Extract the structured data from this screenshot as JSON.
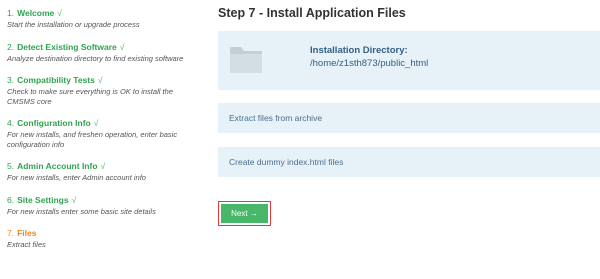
{
  "steps": [
    {
      "num": "1.",
      "label": "Welcome",
      "check": "√",
      "desc": "Start the installation or upgrade process"
    },
    {
      "num": "2.",
      "label": "Detect Existing Software",
      "check": "√",
      "desc": "Analyze destination directory to find existing software"
    },
    {
      "num": "3.",
      "label": "Compatibility Tests",
      "check": "√",
      "desc": "Check to make sure everything is OK to install the CMSMS core"
    },
    {
      "num": "4.",
      "label": "Configuration Info",
      "check": "√",
      "desc": "For new installs, and freshen operation, enter basic configuration info"
    },
    {
      "num": "5.",
      "label": "Admin Account Info",
      "check": "√",
      "desc": "For new installs, enter Admin account info"
    },
    {
      "num": "6.",
      "label": "Site Settings",
      "check": "√",
      "desc": "For new installs enter some basic site details"
    },
    {
      "num": "7.",
      "label": "Files",
      "check": "",
      "desc": "Extract files"
    }
  ],
  "main": {
    "title": "Step 7 - Install Application Files",
    "dir_label": "Installation Directory:",
    "dir_path": "/home/z1sth873/public_html",
    "action1": "Extract files from archive",
    "action2": "Create dummy index.html files",
    "next_label": "Next →"
  },
  "colors": {
    "done_step": "#2fa34f",
    "current_step": "#f0871d",
    "panel_bg": "#e6f1f8",
    "panel_text": "#355f85",
    "button_bg": "#49b76a",
    "highlight_border": "#e33b3b"
  },
  "icons": {
    "folder": "folder-icon"
  }
}
